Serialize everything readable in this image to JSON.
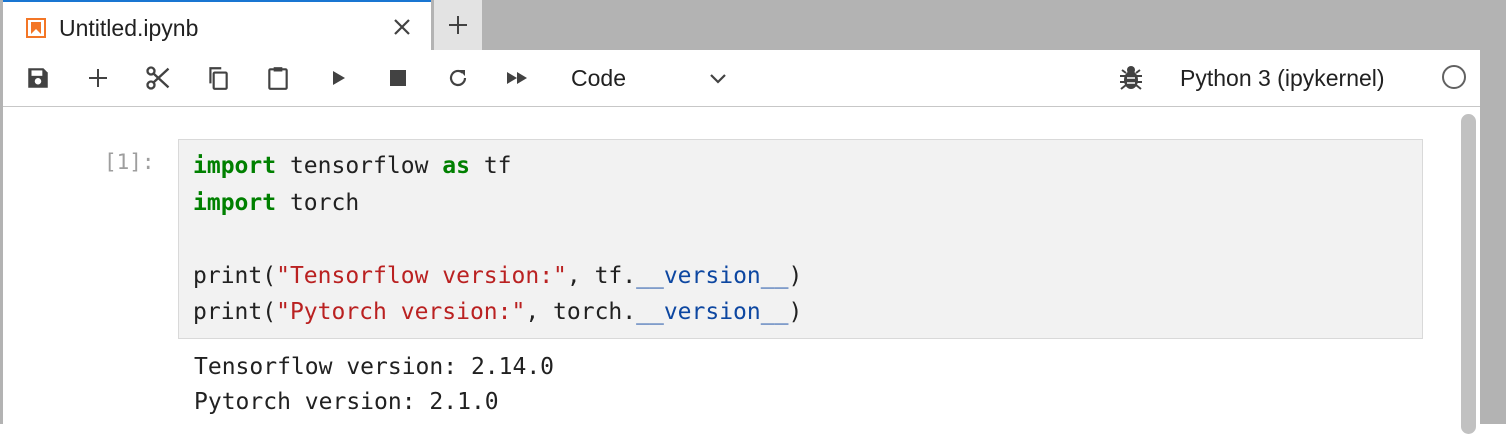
{
  "tab": {
    "title": "Untitled.ipynb",
    "icon": "notebook-icon",
    "accent": "#f37626"
  },
  "toolbar": {
    "icons": [
      "save-icon",
      "add-cell-icon",
      "cut-icon",
      "copy-icon",
      "paste-icon",
      "run-icon",
      "stop-icon",
      "restart-icon",
      "run-all-icon"
    ],
    "cell_type": "Code",
    "kernel_name": "Python 3 (ipykernel)"
  },
  "cell": {
    "prompt": "[1]:",
    "code_lines": [
      [
        {
          "t": "import",
          "c": "kw"
        },
        {
          "t": " tensorflow "
        },
        {
          "t": "as",
          "c": "kw"
        },
        {
          "t": " tf"
        }
      ],
      [
        {
          "t": "import",
          "c": "kw"
        },
        {
          "t": " torch"
        }
      ],
      [],
      [
        {
          "t": "print("
        },
        {
          "t": "\"Tensorflow version:\"",
          "c": "str"
        },
        {
          "t": ", tf."
        },
        {
          "t": "__version__",
          "c": "dunder"
        },
        {
          "t": ")"
        }
      ],
      [
        {
          "t": "print("
        },
        {
          "t": "\"Pytorch version:\"",
          "c": "str"
        },
        {
          "t": ", torch."
        },
        {
          "t": "__version__",
          "c": "dunder"
        },
        {
          "t": ")"
        }
      ]
    ],
    "output_lines": [
      "Tensorflow version: 2.14.0",
      "Pytorch version: 2.1.0"
    ]
  }
}
